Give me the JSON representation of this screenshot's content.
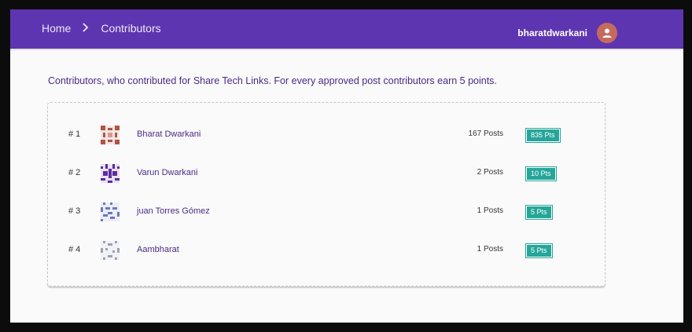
{
  "header": {
    "home_label": "Home",
    "separator": ">",
    "current": "Contributors",
    "username": "bharatdwarkani",
    "bar_color": "#5e35b1",
    "avatar_icon": "person-icon"
  },
  "intro": "Contributors, who contributed for Share Tech Links. For every approved post contributors earn 5 points.",
  "contributors": [
    {
      "rank": "# 1",
      "name": "Bharat Dwarkani",
      "posts": "167 Posts",
      "points": "835 Pts",
      "avatar_color": "#b05446"
    },
    {
      "rank": "# 2",
      "name": "Varun Dwarkani",
      "posts": "2 Posts",
      "points": "10 Pts",
      "avatar_color": "#5b2d9c"
    },
    {
      "rank": "# 3",
      "name": "juan Torres Gómez",
      "posts": "1 Posts",
      "points": "5 Pts",
      "avatar_color": "#6f79b8"
    },
    {
      "rank": "# 4",
      "name": "Aambharat",
      "posts": "1 Posts",
      "points": "5 Pts",
      "avatar_color": "#9aa3b4"
    }
  ],
  "badge_color": "#26a69a"
}
